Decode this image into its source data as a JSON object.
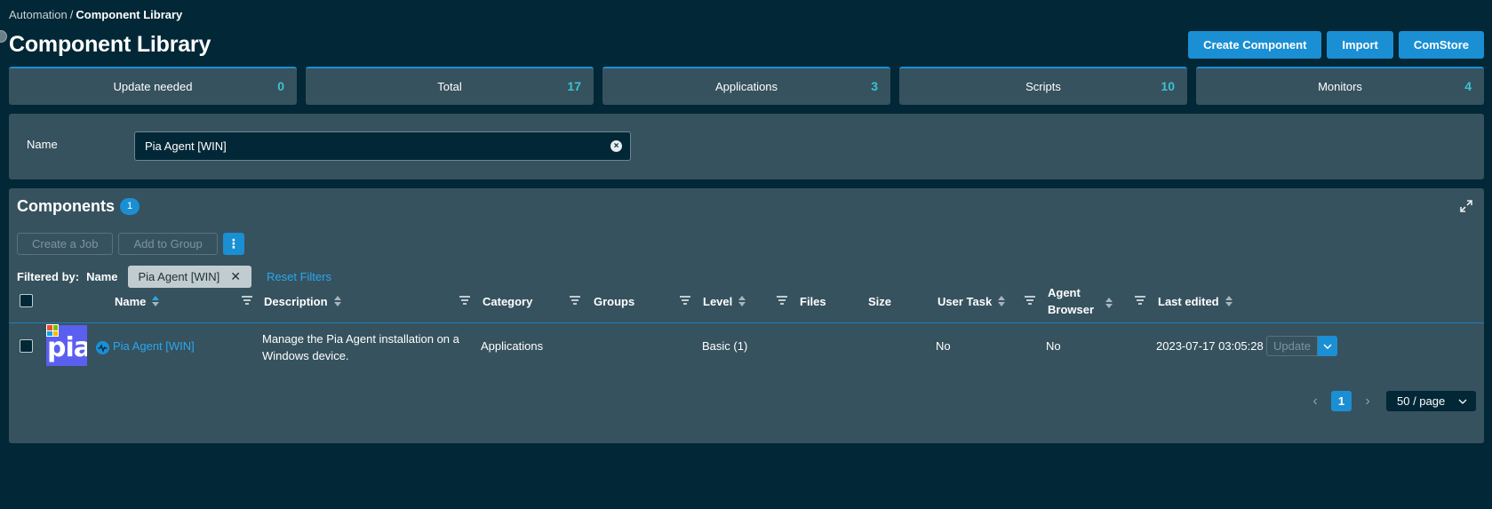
{
  "breadcrumb": {
    "parent": "Automation",
    "separator": "/",
    "current": "Component Library"
  },
  "page_title": "Component Library",
  "header_buttons": {
    "create": "Create Component",
    "import": "Import",
    "comstore": "ComStore"
  },
  "stats": [
    {
      "label": "Update needed",
      "count": "0"
    },
    {
      "label": "Total",
      "count": "17"
    },
    {
      "label": "Applications",
      "count": "3"
    },
    {
      "label": "Scripts",
      "count": "10"
    },
    {
      "label": "Monitors",
      "count": "4"
    }
  ],
  "filter": {
    "name_label": "Name",
    "name_value": "Pia Agent [WIN]"
  },
  "components": {
    "title": "Components",
    "count": "1",
    "actions": {
      "create_job": "Create a Job",
      "add_to_group": "Add to Group",
      "more": "⋮"
    },
    "filtered_by": {
      "label": "Filtered by:",
      "field": "Name",
      "value": "Pia Agent [WIN]",
      "reset": "Reset Filters"
    },
    "columns": {
      "name": "Name",
      "description": "Description",
      "category": "Category",
      "groups": "Groups",
      "level": "Level",
      "files": "Files",
      "size": "Size",
      "user_task": "User Task",
      "agent_browser_1": "Agent",
      "agent_browser_2": "Browser",
      "last_edited": "Last edited"
    },
    "rows": [
      {
        "logo_text": "pia",
        "name": "Pia Agent [WIN]",
        "description_1": "Manage the Pia Agent installation on a",
        "description_2": "Windows device.",
        "category": "Applications",
        "groups": "",
        "level": "Basic (1)",
        "files": "",
        "size": "",
        "user_task": "No",
        "agent_browser": "No",
        "last_edited": "2023-07-17 03:05:28",
        "update_label": "Update"
      }
    ],
    "pagination": {
      "current_page": "1",
      "page_size": "50 / page",
      "prev": "‹",
      "next": "›"
    }
  },
  "colors": {
    "background": "#022736",
    "panel": "#36525e",
    "accent": "#1b8fd4",
    "count": "#3bc3cf",
    "link": "#29a7ef",
    "logo": "#5b5ff0"
  }
}
